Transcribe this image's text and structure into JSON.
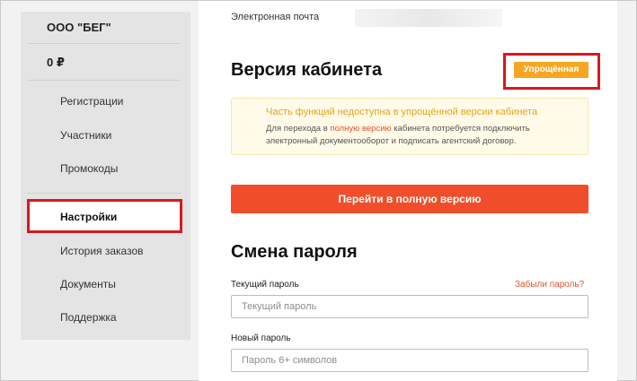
{
  "sidebar": {
    "company": "ООО \"БЕГ\"",
    "balance": "0 ₽",
    "items": [
      {
        "label": "Регистрации"
      },
      {
        "label": "Участники"
      },
      {
        "label": "Промокоды"
      },
      {
        "label": "Настройки"
      },
      {
        "label": "История заказов"
      },
      {
        "label": "Документы"
      },
      {
        "label": "Поддержка"
      }
    ]
  },
  "main": {
    "email_label": "Электронная почта",
    "version_heading": "Версия кабинета",
    "version_badge": "Упрощённая",
    "notice": {
      "title": "Часть функций недоступна в упрощённой версии кабинета",
      "text_before": "Для перехода в ",
      "link": "полную версию",
      "text_after": " кабинета потребуется подключить электронный документооборот и подписать агентский договор."
    },
    "cta_label": "Перейти в полную версию",
    "password_heading": "Смена пароля",
    "current_password_label": "Текущий пароль",
    "forgot_link": "Забыли пароль?",
    "current_password_placeholder": "Текущий пароль",
    "new_password_label": "Новый пароль",
    "new_password_placeholder": "Пароль 6+ символов"
  },
  "colors": {
    "accent": "#f04e2a",
    "badge": "#f6a623",
    "highlight_box": "#d7191f",
    "notice_bg": "#fffbe8"
  }
}
